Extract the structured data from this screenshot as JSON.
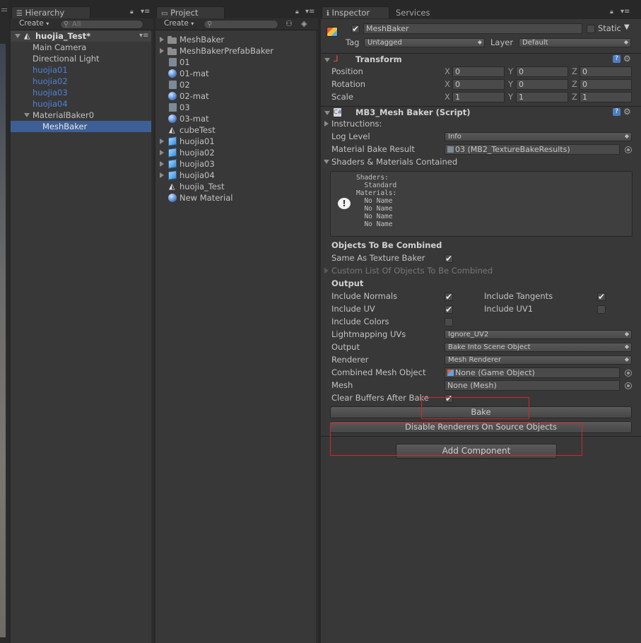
{
  "hierarchy": {
    "tab_label": "Hierarchy",
    "create_label": "Create",
    "search_placeholder": "All",
    "scene_name": "huojia_Test*",
    "items": [
      {
        "label": "Main Camera",
        "style": "normal"
      },
      {
        "label": "Directional Light",
        "style": "normal"
      },
      {
        "label": "huojia01",
        "style": "prefab"
      },
      {
        "label": "huojia02",
        "style": "prefab"
      },
      {
        "label": "huojia03",
        "style": "prefab"
      },
      {
        "label": "huojia04",
        "style": "prefab"
      },
      {
        "label": "MaterialBaker0",
        "style": "normal"
      },
      {
        "label": "MeshBaker",
        "style": "selected"
      }
    ]
  },
  "project": {
    "tab_label": "Project",
    "create_label": "Create",
    "items": [
      {
        "label": "MeshBaker",
        "icon": "folder-icon"
      },
      {
        "label": "MeshBakerPrefabBaker",
        "icon": "folder-icon"
      },
      {
        "label": "01",
        "icon": "asset-icon"
      },
      {
        "label": "01-mat",
        "icon": "material-icon"
      },
      {
        "label": "02",
        "icon": "asset-icon"
      },
      {
        "label": "02-mat",
        "icon": "material-icon"
      },
      {
        "label": "03",
        "icon": "asset-icon"
      },
      {
        "label": "03-mat",
        "icon": "material-icon"
      },
      {
        "label": "cubeTest",
        "icon": "scene-icon"
      },
      {
        "label": "huojia01",
        "icon": "prefab-icon"
      },
      {
        "label": "huojia02",
        "icon": "prefab-icon"
      },
      {
        "label": "huojia03",
        "icon": "prefab-icon"
      },
      {
        "label": "huojia04",
        "icon": "prefab-icon"
      },
      {
        "label": "huojia_Test",
        "icon": "scene-icon"
      },
      {
        "label": "New Material",
        "icon": "material-icon"
      }
    ]
  },
  "inspector": {
    "tab_label": "Inspector",
    "services_tab": "Services",
    "object_name": "MeshBaker",
    "static_label": "Static",
    "tag_label": "Tag",
    "tag_value": "Untagged",
    "layer_label": "Layer",
    "layer_value": "Default",
    "transform": {
      "title": "Transform",
      "rows": [
        {
          "label": "Position",
          "x": "0",
          "y": "0",
          "z": "0"
        },
        {
          "label": "Rotation",
          "x": "0",
          "y": "0",
          "z": "0"
        },
        {
          "label": "Scale",
          "x": "1",
          "y": "1",
          "z": "1"
        }
      ],
      "axis_x": "X",
      "axis_y": "Y",
      "axis_z": "Z"
    },
    "mesh_baker": {
      "title": "MB3_Mesh Baker (Script)",
      "instructions": "Instructions:",
      "log_level_label": "Log Level",
      "log_level_value": "Info",
      "material_bake_result_label": "Material Bake Result",
      "material_bake_result_value": "03 (MB2_TextureBakeResults)",
      "shaders_materials_label": "Shaders & Materials Contained",
      "help_text": "Shaders:\n  Standard\nMaterials:\n  No Name\n  No Name\n  No Name\n  No Name",
      "objects_to_be_combined": "Objects To Be Combined",
      "same_as_texture_baker": "Same As Texture Baker",
      "custom_list": "Custom List Of Objects To Be Combined",
      "output_header": "Output",
      "include_normals": "Include Normals",
      "include_tangents": "Include Tangents",
      "include_uv": "Include UV",
      "include_uv1": "Include UV1",
      "include_colors": "Include Colors",
      "lightmapping_uvs_label": "Lightmapping UVs",
      "lightmapping_uvs_value": "Ignore_UV2",
      "output_label": "Output",
      "output_value": "Bake Into Scene Object",
      "renderer_label": "Renderer",
      "renderer_value": "Mesh Renderer",
      "combined_mesh_object_label": "Combined Mesh Object",
      "combined_mesh_object_value": "None (Game Object)",
      "mesh_label": "Mesh",
      "mesh_value": "None (Mesh)",
      "clear_buffers_label": "Clear Buffers After Bake",
      "bake_button": "Bake",
      "disable_renderers_button": "Disable Renderers On Source Objects"
    },
    "add_component_button": "Add Component"
  },
  "colors": {
    "panel_bg": "#383838",
    "selection": "#3e5f96",
    "prefab_text": "#4e83d7",
    "annotation_red": "#d3272d"
  }
}
